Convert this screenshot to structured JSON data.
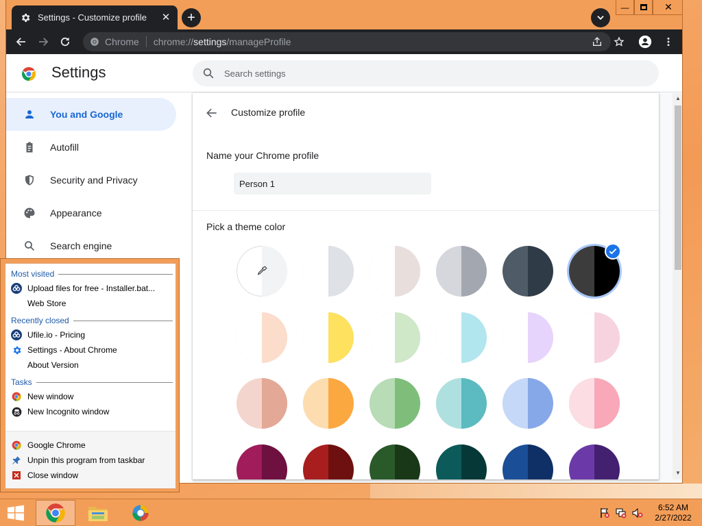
{
  "browser": {
    "tab_title": "Settings - Customize profile",
    "omnibox": {
      "site_label": "Chrome",
      "url_scheme": "chrome://",
      "url_host": "settings",
      "url_path": "/manageProfile"
    }
  },
  "settings": {
    "title": "Settings",
    "search_placeholder": "Search settings",
    "nav": [
      {
        "label": "You and Google",
        "icon": "person-icon",
        "active": true
      },
      {
        "label": "Autofill",
        "icon": "clipboard-icon",
        "active": false
      },
      {
        "label": "Security and Privacy",
        "icon": "shield-icon",
        "active": false
      },
      {
        "label": "Appearance",
        "icon": "palette-icon",
        "active": false
      },
      {
        "label": "Search engine",
        "icon": "search-icon",
        "active": false
      }
    ]
  },
  "page": {
    "title": "Customize profile",
    "name_label": "Name your Chrome profile",
    "name_value": "Person 1",
    "theme_label": "Pick a theme color",
    "theme_rows": [
      [
        {
          "left": "#ffffff",
          "right": "#f1f3f4",
          "picker": true
        },
        {
          "left": "#ffffff",
          "right": "#dee1e6"
        },
        {
          "left": "#ffffff",
          "right": "#e8dfdd"
        },
        {
          "left": "#d5d7dc",
          "right": "#a3a7af"
        },
        {
          "left": "#4f5b66",
          "right": "#2f3b46"
        },
        {
          "left": "#3c3c3c",
          "right": "#000000",
          "selected": true
        }
      ],
      [
        {
          "left": "#ffffff",
          "right": "#fcdccb"
        },
        {
          "left": "#ffffff",
          "right": "#fde15f"
        },
        {
          "left": "#ffffff",
          "right": "#cfe8c8"
        },
        {
          "left": "#ffffff",
          "right": "#b2e6ef"
        },
        {
          "left": "#ffffff",
          "right": "#e7d4fc"
        },
        {
          "left": "#ffffff",
          "right": "#f7d3e0"
        }
      ],
      [
        {
          "left": "#f4d5ce",
          "right": "#e3a896"
        },
        {
          "left": "#fddcb0",
          "right": "#fca840"
        },
        {
          "left": "#b7dcb6",
          "right": "#7ebe7a"
        },
        {
          "left": "#afe0e0",
          "right": "#5bbbc0"
        },
        {
          "left": "#c6d8f8",
          "right": "#87a8e8"
        },
        {
          "left": "#fbdde3",
          "right": "#f8a8b8"
        }
      ],
      [
        {
          "left": "#a01c5a",
          "right": "#6e1040"
        },
        {
          "left": "#a81e1e",
          "right": "#6e1010"
        },
        {
          "left": "#2a5a2a",
          "right": "#183818"
        },
        {
          "left": "#0c5a5a",
          "right": "#073838"
        },
        {
          "left": "#1a4e96",
          "right": "#0f3066"
        },
        {
          "left": "#6c3aa8",
          "right": "#442070"
        }
      ]
    ]
  },
  "jumplist": {
    "most_visited_label": "Most visited",
    "most_visited": [
      {
        "label": "Upload files for free - Installer.bat...",
        "icon": "ufile-icon"
      },
      {
        "label": "Web Store",
        "icon": "blank-icon"
      }
    ],
    "recently_closed_label": "Recently closed",
    "recently_closed": [
      {
        "label": "Ufile.io - Pricing",
        "icon": "ufile-icon"
      },
      {
        "label": "Settings - About Chrome",
        "icon": "gear-icon"
      },
      {
        "label": "About Version",
        "icon": "blank-icon"
      }
    ],
    "tasks_label": "Tasks",
    "tasks": [
      {
        "label": "New window",
        "icon": "chrome-icon"
      },
      {
        "label": "New Incognito window",
        "icon": "incognito-icon"
      }
    ],
    "bottom": [
      {
        "label": "Google Chrome",
        "icon": "chrome-icon"
      },
      {
        "label": "Unpin this program from taskbar",
        "icon": "unpin-icon"
      },
      {
        "label": "Close window",
        "icon": "close-window-icon"
      }
    ]
  },
  "taskbar": {
    "time": "6:52 AM",
    "date": "2/27/2022"
  },
  "colors": {
    "accent": "#1a73e8",
    "titlebar": "#f39e58",
    "dark_chrome": "#202124"
  }
}
